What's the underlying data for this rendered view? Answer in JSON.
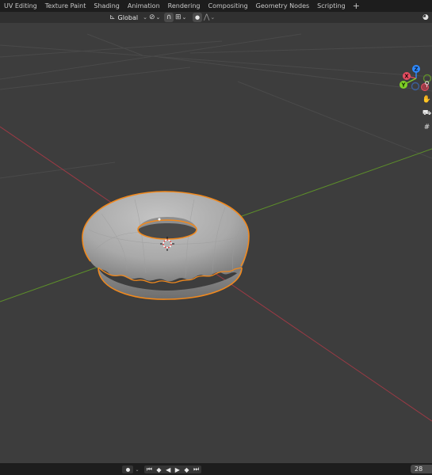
{
  "workspace_tabs": [
    {
      "label": "UV Editing"
    },
    {
      "label": "Texture Paint"
    },
    {
      "label": "Shading"
    },
    {
      "label": "Animation"
    },
    {
      "label": "Rendering"
    },
    {
      "label": "Compositing"
    },
    {
      "label": "Geometry Nodes"
    },
    {
      "label": "Scripting"
    }
  ],
  "add_tab_label": "+",
  "toolbar": {
    "transform_orientation": "Global",
    "orientation_icon": "orientation-axes-icon",
    "pivot_icon": "pivot-point-icon",
    "snap_icon": "magnet-icon",
    "snap_active": true,
    "snap_target_icon": "snap-target-icon",
    "proportional_icon": "proportional-edit-icon",
    "proportional_active": true,
    "falloff_icon": "falloff-curve-icon",
    "overlay_icon": "overlay-icon"
  },
  "gizmo": {
    "axes": [
      {
        "label": "X",
        "color": "#e84d61"
      },
      {
        "label": "Y",
        "color": "#7fd026"
      },
      {
        "label": "Z",
        "color": "#2f8aff"
      }
    ],
    "negative_colors": {
      "x": "#9e3c48",
      "y": "#5f8d2b",
      "z": "#3b5f9c"
    }
  },
  "nav_buttons": [
    {
      "icon": "zoom-icon"
    },
    {
      "icon": "pan-hand-icon"
    },
    {
      "icon": "camera-view-icon"
    },
    {
      "icon": "ortho-grid-icon"
    }
  ],
  "scene": {
    "object": "donut",
    "selected": true,
    "selection_color": "#f0891e",
    "x_axis_color": "#9d3a45",
    "y_axis_color": "#5d8f2a"
  },
  "timeline": {
    "current_frame": "28"
  }
}
